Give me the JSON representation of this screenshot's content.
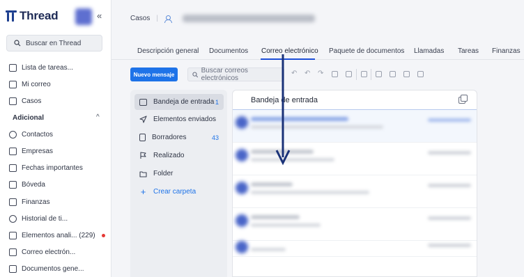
{
  "app": {
    "name": "Thread",
    "collapse_glyph": "«"
  },
  "sidebar": {
    "search_placeholder": "Buscar en Thread",
    "items_top": [
      {
        "label": "Lista de tareas...",
        "icon": "clipboard-icon"
      },
      {
        "label": "Mi correo",
        "icon": "mail-icon"
      },
      {
        "label": "Casos",
        "icon": "briefcase-icon"
      }
    ],
    "section_label": "Adicional",
    "section_chevron": "^",
    "items_extra": [
      {
        "label": "Contactos",
        "icon": "contact-icon"
      },
      {
        "label": "Empresas",
        "icon": "building-icon"
      },
      {
        "label": "Fechas importantes",
        "icon": "calendar-icon"
      },
      {
        "label": "Bóveda",
        "icon": "vault-icon"
      },
      {
        "label": "Finanzas",
        "icon": "finance-icon"
      },
      {
        "label": "Historial de ti...",
        "icon": "history-icon"
      },
      {
        "label": "Elementos anali... (229)",
        "icon": "analytics-icon",
        "has_dot": true
      },
      {
        "label": "Correo electrón...",
        "icon": "email-icon"
      },
      {
        "label": "Documentos gene...",
        "icon": "document-icon"
      }
    ]
  },
  "header": {
    "breadcrumb": "Casos"
  },
  "tabs": [
    {
      "label": "Descripción general"
    },
    {
      "label": "Documentos"
    },
    {
      "label": "Correo electrónico",
      "active": true
    },
    {
      "label": "Paquete de documentos"
    },
    {
      "label": "Llamadas"
    },
    {
      "label": "Tareas"
    },
    {
      "label": "Finanzas"
    }
  ],
  "toolbar": {
    "new_message": "Nuevo mensaje",
    "search_placeholder": "Buscar correos electrónicos"
  },
  "folders": [
    {
      "label": "Bandeja de entrada",
      "count": "1",
      "icon": "inbox-icon",
      "selected": true
    },
    {
      "label": "Elementos enviados",
      "count": "",
      "icon": "send-icon"
    },
    {
      "label": "Borradores",
      "count": "43",
      "icon": "draft-icon"
    },
    {
      "label": "Realizado",
      "count": "",
      "icon": "flag-icon"
    },
    {
      "label": "Folder",
      "count": "",
      "icon": "folder-icon"
    }
  ],
  "create_folder": "Crear carpeta",
  "inbox": {
    "title": "Bandeja de entrada"
  },
  "colors": {
    "accent": "#1e73e8",
    "brand": "#1d3f8f",
    "annotation_arrow": "#1a3278",
    "alert_dot": "#e53935"
  }
}
